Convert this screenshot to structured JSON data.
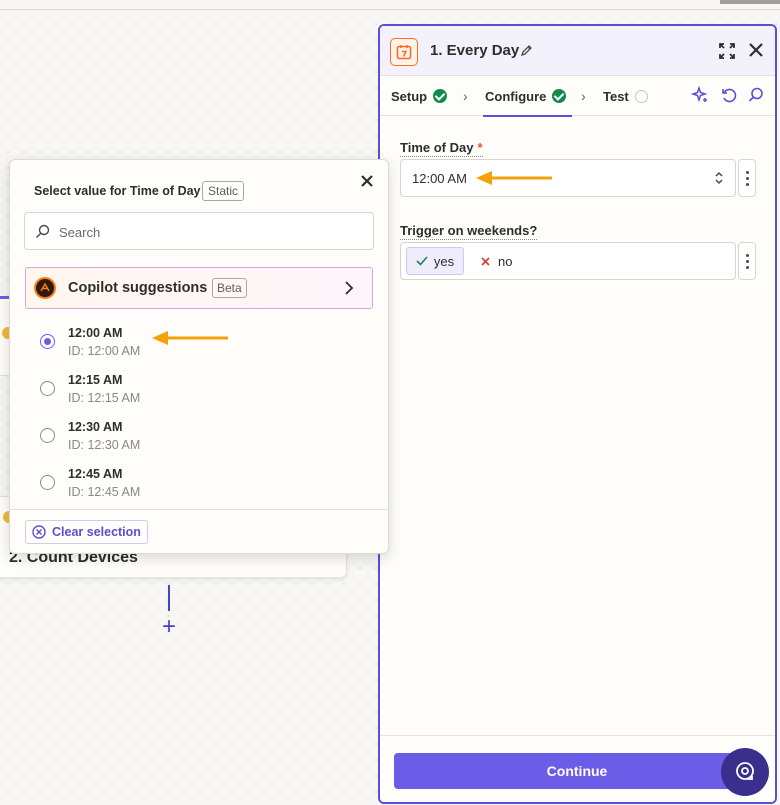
{
  "canvas": {
    "step2_title": "2. Count Devices",
    "add_symbol": "+"
  },
  "panel": {
    "title": "1. Every Day",
    "tabs": [
      {
        "label": "Setup",
        "status": "complete"
      },
      {
        "label": "Configure",
        "status": "complete"
      },
      {
        "label": "Test",
        "status": "pending"
      }
    ],
    "fields": {
      "time_of_day": {
        "label": "Time of Day",
        "required_mark": "*",
        "value": "12:00 AM"
      },
      "weekends": {
        "label": "Trigger on weekends?",
        "yes_label": "yes",
        "no_label": "no",
        "selected": "yes"
      }
    },
    "continue_label": "Continue"
  },
  "popover": {
    "title": "Select value for Time of Day",
    "static_badge": "Static",
    "search_placeholder": "Search",
    "copilot_label": "Copilot suggestions",
    "beta_badge": "Beta",
    "options": [
      {
        "label": "12:00 AM",
        "id_text": "ID: 12:00 AM",
        "selected": true
      },
      {
        "label": "12:15 AM",
        "id_text": "ID: 12:15 AM",
        "selected": false
      },
      {
        "label": "12:30 AM",
        "id_text": "ID: 12:30 AM",
        "selected": false
      },
      {
        "label": "12:45 AM",
        "id_text": "ID: 12:45 AM",
        "selected": false
      }
    ],
    "clear_label": "Clear selection"
  },
  "colors": {
    "accent": "#6b5de8",
    "annotation_arrow": "#f5a10a",
    "success": "#138a4d",
    "app_icon": "#ff6b1a"
  }
}
